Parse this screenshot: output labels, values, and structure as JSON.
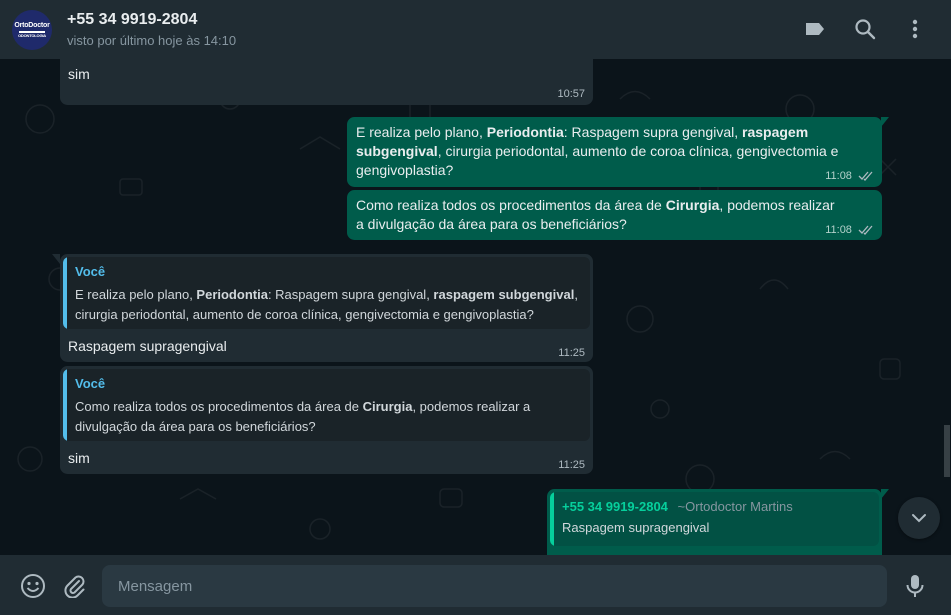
{
  "header": {
    "avatar_text_top": "OrtoDoctor",
    "avatar_text_bottom": "ODONTOLOGIA",
    "contact_name": "+55 34 9919-2804",
    "contact_status": "visto por último hoje às 14:10",
    "icons": [
      "label-icon",
      "search-icon",
      "menu-icon"
    ]
  },
  "messages": [
    {
      "direction": "in",
      "text": "sim",
      "time": "10:57"
    },
    {
      "direction": "out",
      "parts": [
        {
          "t": "E realiza pelo plano, ",
          "b": false
        },
        {
          "t": "Periodontia",
          "b": true
        },
        {
          "t": ": Raspagem supra gengival, ",
          "b": false
        },
        {
          "t": "raspagem subgengival",
          "b": true
        },
        {
          "t": ", cirurgia periodontal, aumento de coroa clínica, gengivectomia e gengivoplastia?",
          "b": false
        }
      ],
      "time": "11:08"
    },
    {
      "direction": "out",
      "parts": [
        {
          "t": "Como realiza todos os procedimentos da área de ",
          "b": false
        },
        {
          "t": "Cirurgia",
          "b": true
        },
        {
          "t": ", podemos realizar a divulgação da área para os beneficiários?",
          "b": false
        }
      ],
      "time": "11:08"
    },
    {
      "direction": "in",
      "quote_author": "Você",
      "quote_parts": [
        {
          "t": "E realiza pelo plano, ",
          "b": false
        },
        {
          "t": "Periodontia",
          "b": true
        },
        {
          "t": ": Raspagem supra gengival, ",
          "b": false
        },
        {
          "t": "raspagem subgengival",
          "b": true
        },
        {
          "t": ", cirurgia periodontal, aumento de coroa clínica, gengivectomia e gengivoplastia?",
          "b": false
        }
      ],
      "text": "Raspagem supragengival",
      "time": "11:25"
    },
    {
      "direction": "in",
      "quote_author": "Você",
      "quote_parts": [
        {
          "t": "Como realiza todos os procedimentos da área de ",
          "b": false
        },
        {
          "t": "Cirurgia",
          "b": true
        },
        {
          "t": ", podemos realizar a divulgação da área para os beneficiários?",
          "b": false
        }
      ],
      "text": "sim",
      "time": "11:25"
    },
    {
      "direction": "out",
      "quote_author": "+55 34 9919-2804",
      "quote_author_alias": "~Ortodoctor Martins",
      "quote_text": "Raspagem supragengival"
    }
  ],
  "footer": {
    "placeholder": "Mensagem",
    "icons": [
      "emoji-icon",
      "attach-icon",
      "microphone-icon"
    ]
  },
  "colors": {
    "header_bg": "#202c33",
    "chat_bg": "#0b141a",
    "bubble_in": "#202c33",
    "bubble_out": "#005c4b",
    "quote_accent_in": "#53bdeb",
    "quote_accent_out": "#06cf9c",
    "tick_color": "#53bdeb"
  }
}
